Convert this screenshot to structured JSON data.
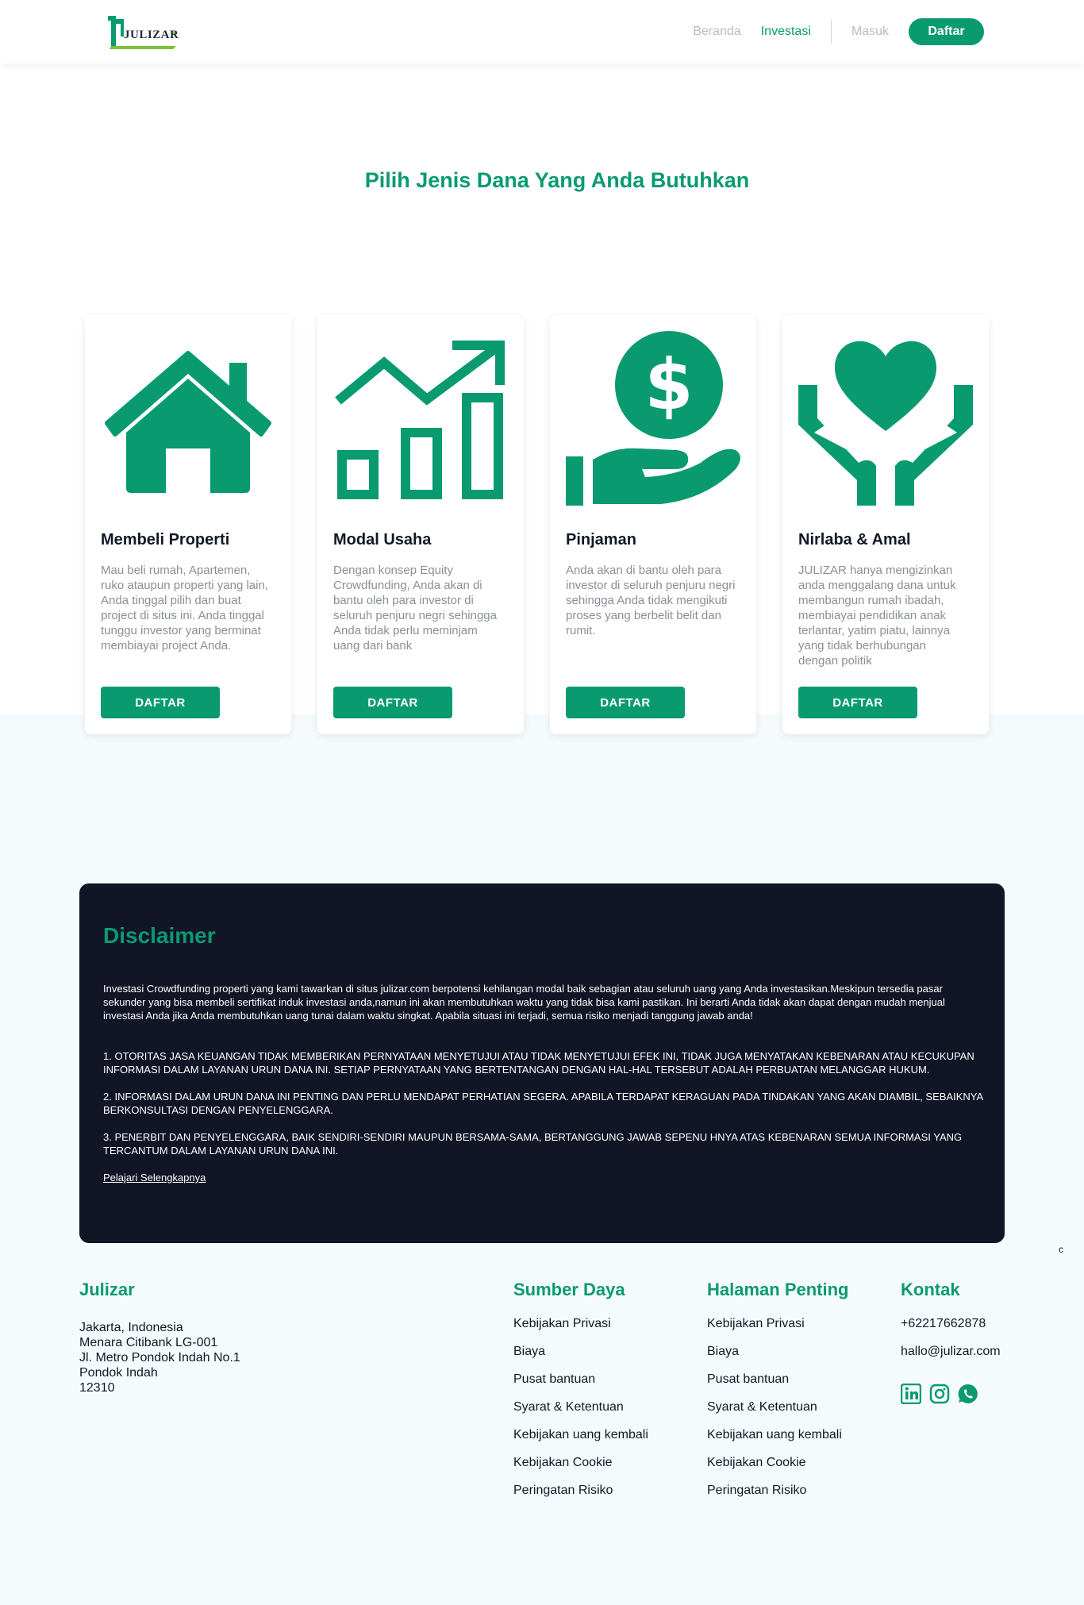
{
  "brand": {
    "logo_text": "JULIZAR",
    "accent_color": "#0a9a70",
    "dark_color": "#111526"
  },
  "nav": {
    "items": [
      "Beranda",
      "Investasi",
      "Masuk"
    ],
    "register_label": "Daftar"
  },
  "main": {
    "title": "Pilih Jenis Dana Yang Anda Butuhkan",
    "cards": [
      {
        "icon": "house-icon",
        "title": "Membeli Properti",
        "description": "Mau beli rumah, Apartemen, ruko ataupun properti yang lain, Anda tinggal pilih dan buat project di situs ini. Anda tinggal tunggu investor yang berminat membiayai project Anda.",
        "button": "DAFTAR"
      },
      {
        "icon": "growth-chart-icon",
        "title": "Modal Usaha",
        "description": "Dengan konsep Equity Crowdfunding, Anda akan di bantu oleh para investor di seluruh penjuru negri sehingga Anda tidak perlu meminjam uang dari bank",
        "button": "DAFTAR"
      },
      {
        "icon": "hand-dollar-icon",
        "title": "Pinjaman",
        "description": "Anda akan di bantu oleh para investor di seluruh penjuru negri sehingga Anda tidak mengikuti proses yang berbelit belit dan rumit.",
        "button": "DAFTAR"
      },
      {
        "icon": "hands-heart-icon",
        "title": "Nirlaba & Amal",
        "description": "JULIZAR hanya mengizinkan anda menggalang dana untuk membangun rumah ibadah, membiayai pendidikan anak terlantar, yatim piatu, lainnya yang tidak berhubungan dengan politik",
        "button": "DAFTAR"
      }
    ]
  },
  "disclaimer": {
    "title": "Disclaimer",
    "paragraphs": [
      "Investasi Crowdfunding properti yang kami tawarkan di situs julizar.com berpotensi kehilangan modal baik sebagian atau seluruh uang yang Anda investasikan.Meskipun tersedia pasar sekunder yang bisa membeli sertifikat induk investasi anda,namun ini akan membutuhkan waktu yang tidak bisa kami pastikan. Ini berarti Anda tidak akan dapat dengan mudah menjual investasi Anda jika Anda membutuhkan uang tunai dalam waktu singkat. Apabila situasi ini terjadi, semua risiko menjadi tanggung jawab anda!",
      "1. OTORITAS JASA KEUANGAN TIDAK MEMBERIKAN PERNYATAAN MENYETUJUI ATAU TIDAK MENYETUJUI EFEK INI, TIDAK JUGA MENYATAKAN KEBENARAN ATAU KECUKUPAN INFORMASI DALAM LAYANAN URUN DANA INI. SETIAP PERNYATAAN YANG BERTENTANGAN DENGAN HAL-HAL TERSEBUT ADALAH PERBUATAN MELANGGAR HUKUM.",
      "2. INFORMASI DALAM URUN DANA INI PENTING DAN PERLU MENDAPAT PERHATIAN SEGERA. APABILA TERDAPAT KERAGUAN PADA TINDAKAN YANG AKAN DIAMBIL, SEBAIKNYA BERKONSULTASI DENGAN PENYELENGGARA.",
      "3. PENERBIT DAN PENYELENGGARA, BAIK SENDIRI-SENDIRI MAUPUN BERSAMA-SAMA, BERTANGGUNG JAWAB SEPENU HNYA ATAS KEBENARAN SEMUA INFORMASI YANG TERCANTUM DALAM LAYANAN URUN DANA INI."
    ],
    "link": "Pelajari Selengkapnya"
  },
  "side_char": "c",
  "footer": {
    "company": {
      "title": "Julizar",
      "address": [
        "Jakarta, Indonesia",
        "Menara Citibank LG-001",
        "Jl. Metro Pondok Indah No.1",
        "Pondok Indah",
        "12310"
      ]
    },
    "resources": {
      "title": "Sumber Daya",
      "links": [
        "Kebijakan Privasi",
        "Biaya",
        "Pusat bantuan",
        "Syarat & Ketentuan",
        "Kebijakan uang kembali",
        "Kebijakan Cookie",
        "Peringatan Risiko"
      ]
    },
    "important": {
      "title": "Halaman Penting",
      "links": [
        "Kebijakan Privasi",
        "Biaya",
        "Pusat bantuan",
        "Syarat & Ketentuan",
        "Kebijakan uang kembali",
        "Kebijakan Cookie",
        "Peringatan Risiko"
      ]
    },
    "contact": {
      "title": "Kontak",
      "phone": "+62217662878",
      "email": "hallo@julizar.com",
      "socials": [
        "linkedin-icon",
        "instagram-icon",
        "whatsapp-icon"
      ]
    }
  }
}
